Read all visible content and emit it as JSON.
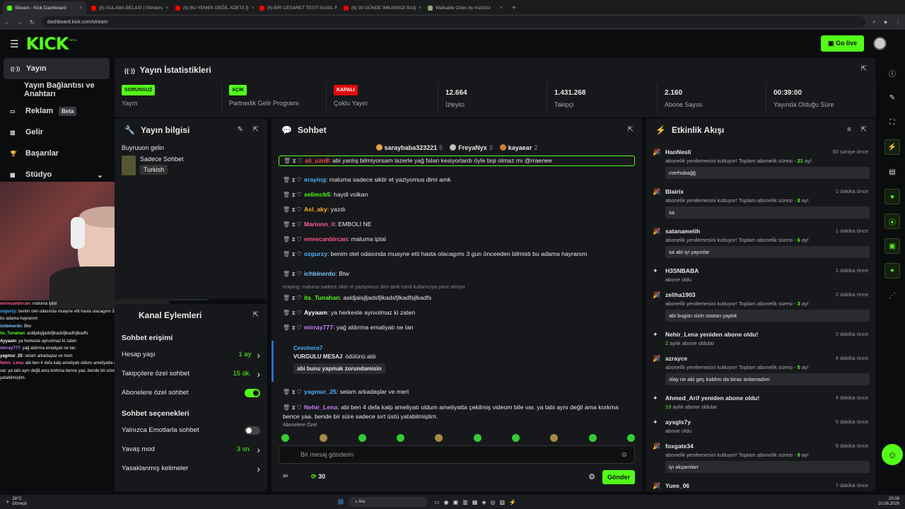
{
  "browser": {
    "tabs": [
      {
        "label": "Stream - Kick Dashboard",
        "color": "#53fc18",
        "active": true
      },
      {
        "label": "(6) SULAMA BELASI | 5Sriders",
        "color": "#ff0000"
      },
      {
        "label": "(6) BU YEMEK DEĞİL ADETA Ş",
        "color": "#ff0000"
      },
      {
        "label": "(6) BİR CESARET TESTİ NASIL F",
        "color": "#ff0000"
      },
      {
        "label": "(6) 30 GÜNDE İMKANSIZI BAŞ",
        "color": "#ff0000"
      },
      {
        "label": "Walkable Cities by mizizizz",
        "color": "#8a7"
      }
    ],
    "new_tab": "+",
    "url": "dashboard.kick.com/stream"
  },
  "header": {
    "logo": "KICK",
    "beta": "BETA",
    "golive": "Go live"
  },
  "sidebar": {
    "items": [
      {
        "label": "Yayın",
        "icon": "((·))",
        "active": true
      },
      {
        "label": "Yayın Bağlantısı ve Anahtarı",
        "icon": ""
      },
      {
        "label": "Reklam",
        "icon": "▭",
        "beta": "Beta"
      },
      {
        "label": "Gelir",
        "icon": "▥"
      },
      {
        "label": "Başarılar",
        "icon": "🏆"
      },
      {
        "label": "Stüdyo",
        "icon": "▦",
        "chevron": "⌄"
      }
    ]
  },
  "overlay_chat": [
    {
      "user": "emrecanbircan",
      "color": "#ff5a8a",
      "text": "maluma iptal"
    },
    {
      "user": "ozgurzy",
      "color": "#4ab0ff",
      "text": "benim otel odasında muayne etti hasta olacagımı 3 gun önceeden bilmisti bu adama hayranım"
    },
    {
      "user": "ichbinerdo",
      "color": "#7fc8ff",
      "text": "Btw"
    },
    {
      "user": "its_Tunahan",
      "color": "#53fc18",
      "text": "asldjalsjljadsfjlkadsfjlkadfsjlkadfs"
    },
    {
      "user": "Ayyaam",
      "color": "#ffffff",
      "text": "ya herkeste aynıolmaz ki zaten"
    },
    {
      "user": "mirray777",
      "color": "#c77dff",
      "text": "yağ aldırma emaliyatı ne lan"
    },
    {
      "user": "yagmur_25",
      "color": "#ffffff",
      "text": "selam arkadaşlar ve mert"
    },
    {
      "user": "Nehir_Lena",
      "color": "#ff5aa0",
      "text": "abi ben 4 defa kalp ameliyatı oldum ameliyatta çekilmiş videom bile var. ya tabi aynı değil ama korkma bence yaa. bende bir süre sadece sırt üstü yatabilmiştim."
    }
  ],
  "stats": {
    "title": "Yayın İstatistikleri",
    "cells": [
      {
        "badge": "SORUNSUZ",
        "badge_color": "#53fc18",
        "label": "Yayın"
      },
      {
        "badge": "AÇIK",
        "badge_color": "#53fc18",
        "label": "Partnerlik Gelir Programı"
      },
      {
        "badge": "KAPALI",
        "badge_color": "#e00b0b",
        "label": "Çoklu Yayın"
      },
      {
        "value": "12.664",
        "label": "İzleyici"
      },
      {
        "value": "1.431.268",
        "label": "Takipçi"
      },
      {
        "value": "2.160",
        "label": "Abone Sayısı"
      },
      {
        "value": "00:39:00",
        "label": "Yayında Olduğu Süre"
      }
    ]
  },
  "info": {
    "title": "Yayın bilgisi",
    "stream_title": "Buyruuon gelin",
    "mode": "Sadece Sohbet",
    "lang": "Turkish"
  },
  "kanal": {
    "title": "Kanal Eylemleri",
    "sec1": "Sohbet erişimi",
    "rows1": [
      {
        "label": "Hesap yaşı",
        "value": "1 ay"
      },
      {
        "label": "Takipçilere özel sohbet",
        "value": "15 dk."
      },
      {
        "label": "Abonelere özel sohbet",
        "toggle": true
      }
    ],
    "sec2": "Sohbet seçenekleri",
    "rows2": [
      {
        "label": "Yalnızca Emotlarla sohbet",
        "toggle": false
      },
      {
        "label": "Yavaş mod",
        "value": "3 sn."
      },
      {
        "label": "Yasaklanmış kelimeler",
        "value": ""
      }
    ]
  },
  "chat": {
    "title": "Sohbet",
    "top": [
      {
        "name": "saraybaba323221",
        "n": "5",
        "color": "#e6a23c"
      },
      {
        "name": "FreyaNyx",
        "n": "3",
        "color": "#c0c0c0"
      },
      {
        "name": "kayaear",
        "n": "2",
        "color": "#cd7f32"
      }
    ],
    "messages": [
      {
        "user": "ali_uzn8",
        "color": "#ff4a4a",
        "text": "abi yanlış bilmiyorsam lazerle yağ falan kesiyorlardı öyle bişi olmaz mı @rraenee"
      },
      {
        "user": "eraying",
        "color": "#4ab0ff",
        "text": "maluma sadece siktir et yaziyomus dimi amk"
      },
      {
        "user": "selimcb5",
        "color": "#53fc18",
        "text": "haydi volkan"
      },
      {
        "user": "Asl_aky",
        "color": "#ffb020",
        "text": "yazdı"
      },
      {
        "user": "Marionn_0",
        "color": "#ff5aa0",
        "text": "EMBOLİ NE"
      },
      {
        "user": "emrecanbircan",
        "color": "#ff5a8a",
        "text": "maluma iptal"
      },
      {
        "user": "ozgurzy",
        "color": "#4ab0ff",
        "text": "benim otel odasında muayne etti hasta olacagımı 3 gun önceeden bilmisti bu adama hayranım"
      },
      {
        "user": "ichbinerdo",
        "color": "#7fc8ff",
        "text": "Btw"
      },
      {
        "reply": "eraying: maluma sadece siktir et yaziyomus dimi amk isimli kullanıcıya yanıt veriyor"
      },
      {
        "user": "its_Tunahan",
        "color": "#53fc18",
        "text": "asldjalsjljadsfjlkadsfjlkadfsjlkadfs"
      },
      {
        "user": "Ayyaam",
        "color": "#ffffff",
        "text": "ya herkeste aynıolmaz ki zaten"
      },
      {
        "user": "mirray777",
        "color": "#c77dff",
        "text": "yağ aldırma emaliyatı ne lan"
      }
    ],
    "reward": {
      "user": "Cevohero7",
      "title": "VURGULU MESAJ",
      "suffix": "ödülünü aldı",
      "text": "abi bunu yapmak zorundamisin"
    },
    "msg2": [
      {
        "user": "yagmur_25",
        "color": "#4ab0ff",
        "text": "selam arkadaşlar ve mert"
      },
      {
        "user": "Nehir_Lena",
        "color": "#c77dff",
        "text": "abi ben 4 defa kalp ameliyatı oldum ameliyatta çekilmiş videom bile var. ya tabi aynı değil ama korkma bence yaa. bende bir süre sadece sırt üstü yatabilmiştim."
      }
    ],
    "subs_label": "Abonelere Özel",
    "placeholder": "Bir mesaj gönderin",
    "points": "30",
    "send": "Gönder"
  },
  "activity": {
    "title": "Etkinlik Akışı",
    "events": [
      {
        "name": "HanNesli",
        "time": "50 saniye önce",
        "sub": "abonelik yenilemesini kutluyor! Toplam abonelik süresi - ",
        "subn": "21",
        "subu": " ay!",
        "box": "merhobağğ"
      },
      {
        "name": "Blairix",
        "time": "1 dakika önce",
        "sub": "abonelik yenilemesini kutluyor! Toplam abonelik süresi - ",
        "subn": "8",
        "subu": " ay!",
        "box": "sa"
      },
      {
        "name": "satanamelih",
        "time": "1 dakika önce",
        "sub": "abonelik yenilemesini kutluyor! Toplam abonelik süresi - ",
        "subn": "6",
        "subu": " ay!",
        "box": "sa abi iyi yayınlar"
      },
      {
        "name": "H3SNBABA",
        "time": "1 dakika önce",
        "sub": "abone oldu",
        "subn": "",
        "subu": "",
        "box": ""
      },
      {
        "name": "zeliha1903",
        "time": "2 dakika önce",
        "sub": "abonelik yenilemesini kutluyor! Toplam abonelik süresi - ",
        "subn": "3",
        "subu": " ay!",
        "box": "abi bugün sizin sostan yaptık"
      },
      {
        "name": "Nehir_Lena yeniden abone oldu!",
        "time": "2 dakika önce",
        "sub": " aylık abone oldular",
        "subn": "2",
        "subu": "",
        "box": "",
        "pre": true
      },
      {
        "name": "azrayce",
        "time": "4 dakika önce",
        "sub": "abonelik yenilemesini kutluyor! Toplam abonelik süresi - ",
        "subn": "5",
        "subu": " ay!",
        "box": "olay ne abi geç kaldım da biraz anlamadım"
      },
      {
        "name": "Ahmed_Arif yeniden abone oldu!",
        "time": "4 dakika önce",
        "sub": " aylık abone oldular",
        "subn": "19",
        "subu": "",
        "box": "",
        "pre": true
      },
      {
        "name": "aysgls7y",
        "time": "5 dakika önce",
        "sub": "abone oldu",
        "subn": "",
        "subu": "",
        "box": ""
      },
      {
        "name": "foxgate34",
        "time": "6 dakika önce",
        "sub": "abonelik yenilemesini kutluyor! Toplam abonelik süresi - ",
        "subn": "9",
        "subu": " ay!",
        "box": "iyi akşamlarr"
      },
      {
        "name": "Yuee_06",
        "time": "7 dakika önce",
        "sub": "",
        "subn": "",
        "subu": "",
        "box": ""
      }
    ]
  },
  "taskbar": {
    "weather": "28°C",
    "weather2": "Güneşli",
    "search": "Ara",
    "time": "20:09",
    "date": "10.08.2026"
  }
}
